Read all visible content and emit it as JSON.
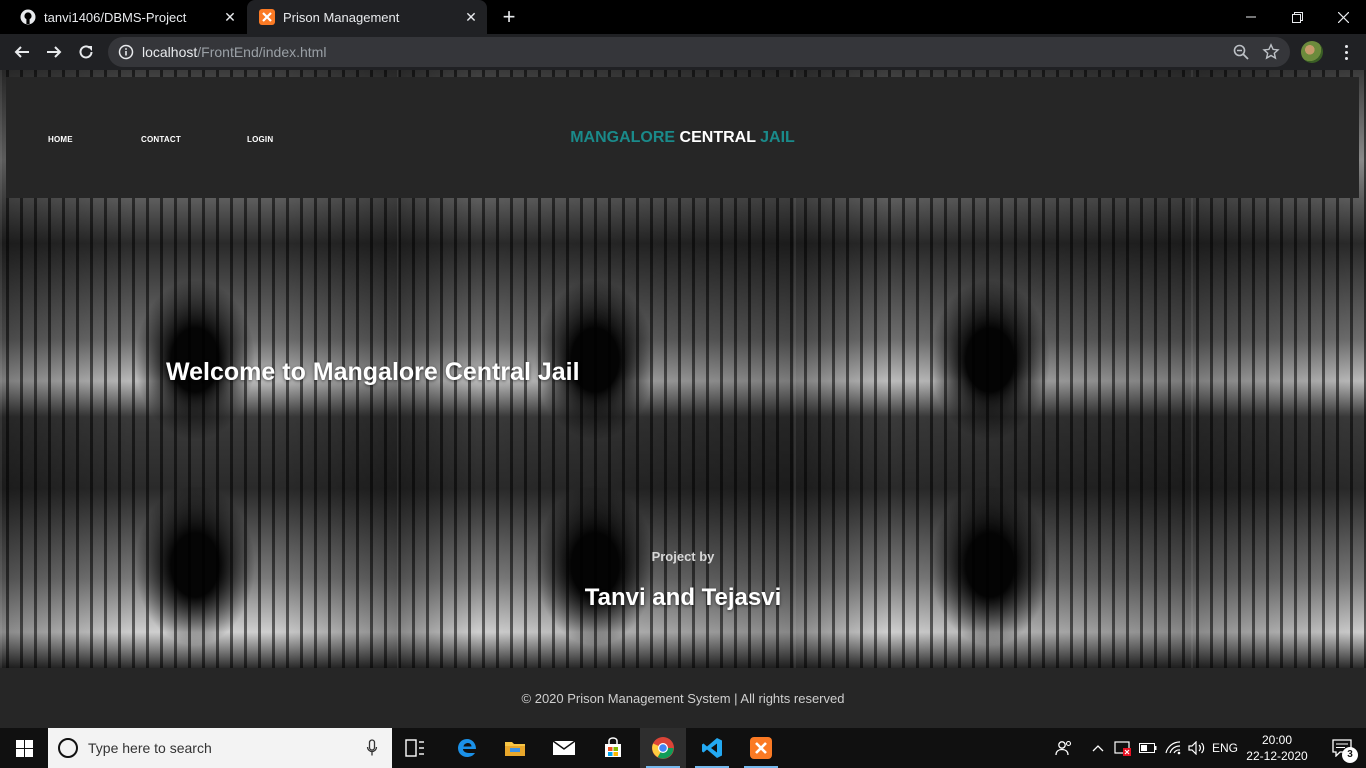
{
  "browser": {
    "tabs": [
      {
        "title": "tanvi1406/DBMS-Project",
        "icon": "github-icon",
        "active": false
      },
      {
        "title": "Prison Management",
        "icon": "xampp-icon",
        "active": true
      }
    ],
    "url": {
      "host": "localhost",
      "path": "/FrontEnd/index.html"
    }
  },
  "site": {
    "nav": {
      "home": "HOME",
      "contact": "CONTACT",
      "login": "LOGIN"
    },
    "brand": {
      "part1": "MANGALORE",
      "part2": "CENTRAL",
      "part3": "JAIL",
      "accent": "#1a8a8a"
    },
    "welcome": "Welcome to Mangalore Central Jail",
    "project_by": "Project by",
    "authors": "Tanvi and Tejasvi",
    "footer": "© 2020 Prison Management System | All rights reserved"
  },
  "taskbar": {
    "search_placeholder": "Type here to search",
    "lang": "ENG",
    "time": "20:00",
    "date": "22-12-2020",
    "notifications": "3"
  }
}
